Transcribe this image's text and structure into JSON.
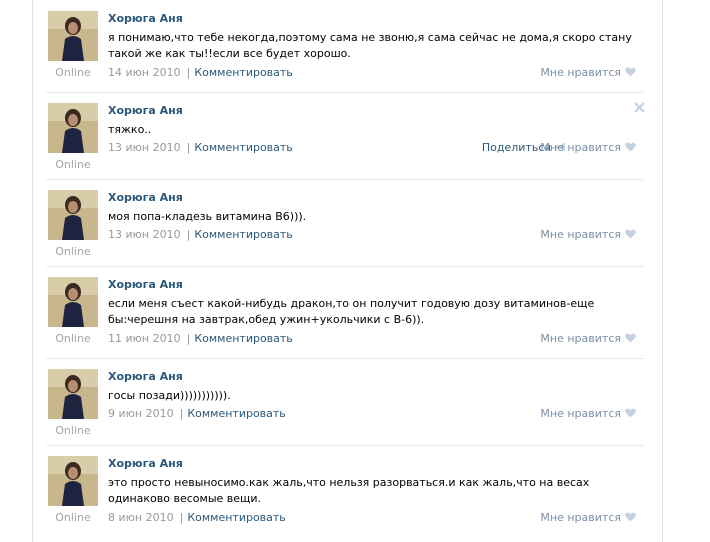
{
  "posts": [
    {
      "author": "Хорюга Аня",
      "text": "я понимаю,что тебе некогда,поэтому сама не звоню,я сама сейчас не дома,я скоро стану такой же как ты!!если все будет хорошо.",
      "date": "14 июн 2010",
      "comment": "Комментировать",
      "like": "Мне нравится",
      "online": "Online"
    },
    {
      "author": "Хорюга Аня",
      "text": "тяжко..",
      "date": "13 июн 2010",
      "comment": "Комментировать",
      "like": "Мне нравится",
      "share": "Поделиться",
      "online": "Online"
    },
    {
      "author": "Хорюга Аня",
      "text": "моя попа-кладезь витамина В6))).",
      "date": "13 июн 2010",
      "comment": "Комментировать",
      "like": "Мне нравится",
      "online": "Online"
    },
    {
      "author": "Хорюга Аня",
      "text": "если меня съест какой-нибудь дракон,то он получит годовую дозу витаминов-еще бы:черешня на завтрак,обед ужин+укольчики с В-6)).",
      "date": "11 июн 2010",
      "comment": "Комментировать",
      "like": "Мне нравится",
      "online": "Online"
    },
    {
      "author": "Хорюга Аня",
      "text": "госы позади))))))))))).",
      "date": "9 июн 2010",
      "comment": "Комментировать",
      "like": "Мне нравится",
      "online": "Online"
    },
    {
      "author": "Хорюга Аня",
      "text": "это просто невыносимо.как жаль,что нельзя разорваться.и как жаль,что на весах одинаково весомые вещи.",
      "date": "8 июн 2010",
      "comment": "Комментировать",
      "like": "Мне нравится",
      "online": "Online"
    }
  ],
  "icons": {
    "like": "heart-icon",
    "share": "megaphone-icon",
    "delete": "close-icon"
  },
  "colors": {
    "link": "#2b587a",
    "muted": "#999999",
    "like": "#7a8fa8"
  }
}
